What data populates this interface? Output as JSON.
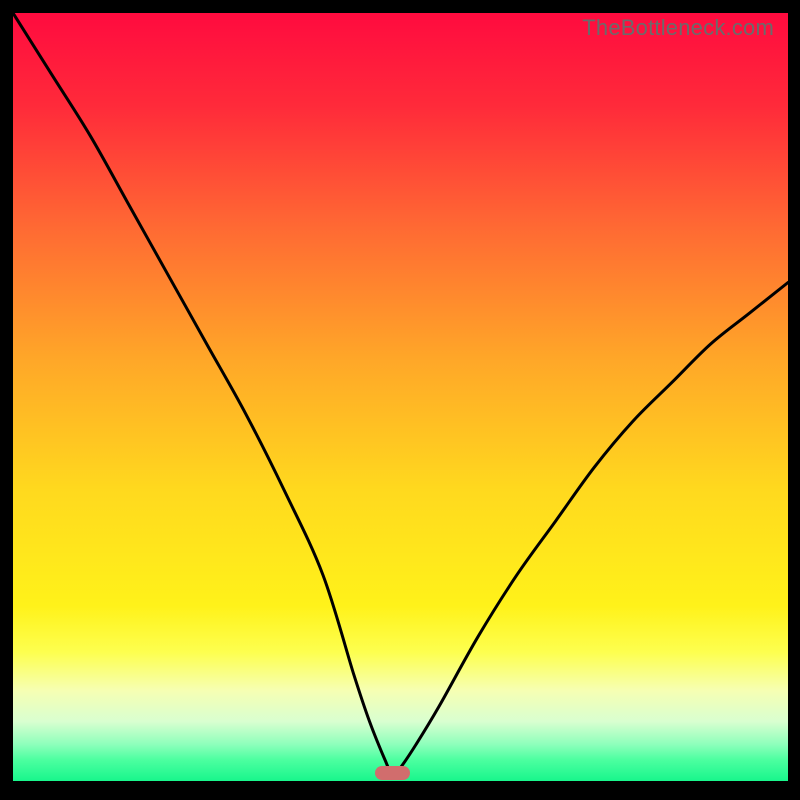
{
  "watermark": {
    "text": "TheBottleneck.com"
  },
  "gradient": {
    "stops": [
      {
        "pct": 0,
        "color": "#ff0b3f"
      },
      {
        "pct": 12,
        "color": "#ff2a3a"
      },
      {
        "pct": 28,
        "color": "#ff6a33"
      },
      {
        "pct": 45,
        "color": "#ffa728"
      },
      {
        "pct": 62,
        "color": "#ffd91e"
      },
      {
        "pct": 77,
        "color": "#fff21a"
      },
      {
        "pct": 83,
        "color": "#fdff4f"
      },
      {
        "pct": 88,
        "color": "#f6ffb3"
      },
      {
        "pct": 92,
        "color": "#d9ffd0"
      },
      {
        "pct": 95,
        "color": "#8dffbb"
      },
      {
        "pct": 97,
        "color": "#4cffa0"
      },
      {
        "pct": 100,
        "color": "#13f58a"
      }
    ]
  },
  "axis": {
    "x_range": [
      0,
      100
    ],
    "y_range": [
      0,
      100
    ]
  },
  "marker": {
    "x_center_pct": 49,
    "width_pct": 4.5
  },
  "chart_data": {
    "type": "line",
    "title": "",
    "xlabel": "",
    "ylabel": "",
    "xlim": [
      0,
      100
    ],
    "ylim": [
      0,
      100
    ],
    "series": [
      {
        "name": "bottleneck-curve",
        "x": [
          0,
          5,
          10,
          15,
          20,
          25,
          30,
          35,
          40,
          44,
          46,
          48,
          49,
          50,
          52,
          55,
          60,
          65,
          70,
          75,
          80,
          85,
          90,
          95,
          100
        ],
        "y": [
          100,
          92,
          84,
          75,
          66,
          57,
          48,
          38,
          27,
          14,
          8,
          3,
          1,
          2,
          5,
          10,
          19,
          27,
          34,
          41,
          47,
          52,
          57,
          61,
          65
        ]
      }
    ],
    "optimum_marker": {
      "x_center": 49,
      "width": 4.5
    },
    "notes": "V-shaped curve on a vertical heat gradient; minimum near x≈49%. Left branch reaches 100 at x=0; right branch rises to about 65 at x=100."
  }
}
